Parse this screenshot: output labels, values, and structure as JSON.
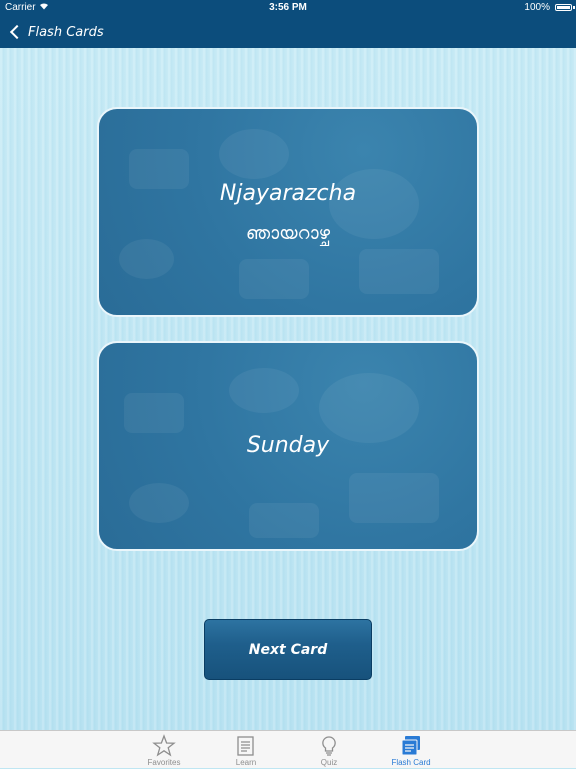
{
  "status_bar": {
    "carrier": "Carrier",
    "time": "3:56 PM",
    "battery": "100%"
  },
  "nav": {
    "back_label": "Flash Cards"
  },
  "card_front": {
    "transliteration": "Njayarazcha",
    "native": "ഞായറാഴ്ച"
  },
  "card_back": {
    "translation": "Sunday"
  },
  "next_button": {
    "label": "Next Card"
  },
  "tabs": [
    {
      "label": "Favorites",
      "icon": "star-icon",
      "active": false
    },
    {
      "label": "Learn",
      "icon": "document-icon",
      "active": false
    },
    {
      "label": "Quiz",
      "icon": "lightbulb-icon",
      "active": false
    },
    {
      "label": "Flash Card",
      "icon": "flash-card-icon",
      "active": true
    }
  ],
  "colors": {
    "nav_bar": "#0c4d7c",
    "card": "#2f75a1",
    "active_tab": "#2a7bd5",
    "inactive_tab": "#8e8e8e"
  }
}
